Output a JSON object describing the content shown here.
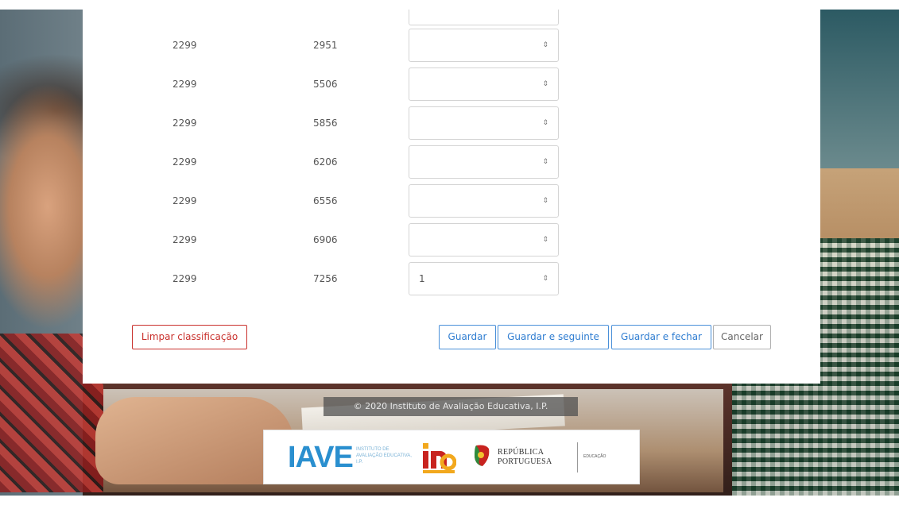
{
  "rows": [
    {
      "col1": "2299",
      "col2": "2951",
      "value": ""
    },
    {
      "col1": "2299",
      "col2": "5506",
      "value": ""
    },
    {
      "col1": "2299",
      "col2": "5856",
      "value": ""
    },
    {
      "col1": "2299",
      "col2": "6206",
      "value": ""
    },
    {
      "col1": "2299",
      "col2": "6556",
      "value": ""
    },
    {
      "col1": "2299",
      "col2": "6906",
      "value": ""
    },
    {
      "col1": "2299",
      "col2": "7256",
      "value": "1"
    }
  ],
  "select_arrow": "⇕",
  "buttons": {
    "clear": "Limpar classificação",
    "save": "Guardar",
    "save_next": "Guardar e seguinte",
    "save_close": "Guardar e fechar",
    "cancel": "Cancelar"
  },
  "footer": {
    "copyright": "© 2020 Instituto de Avaliação Educativa, I.P.",
    "iave": "IAVE",
    "iave_sub": "INSTITUTO DE AVALIAÇÃO EDUCATIVA, I.P.",
    "republica": "REPÚBLICA",
    "portuguesa": "PORTUGUESA",
    "educacao": "EDUCAÇÃO"
  },
  "colors": {
    "danger": "#c9302c",
    "primary": "#2f7dd1",
    "iave_blue": "#2a8fcf"
  }
}
